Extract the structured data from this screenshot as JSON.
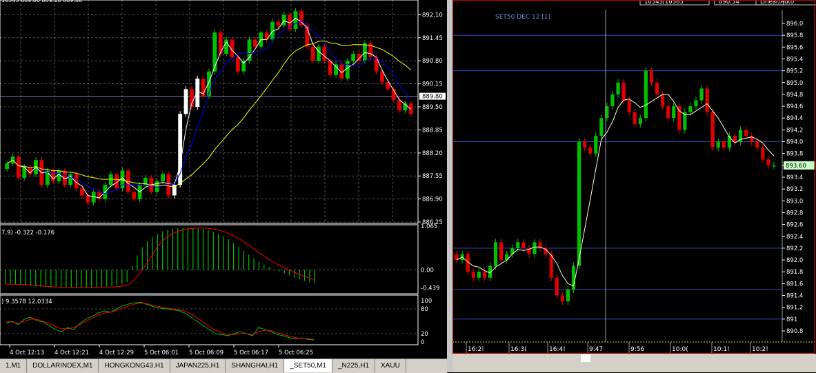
{
  "left_chart": {
    "price_labels": [
      "892.10",
      "891.45",
      "890.80",
      "890.15",
      "889.50",
      "888.85",
      "888.20",
      "887.55",
      "886.90",
      "886.25"
    ],
    "current_price": "889.80",
    "macd_label": "7,9) -0.322 -0.176",
    "macd_ticks": [
      "1.065",
      "0.00",
      "-0.439"
    ],
    "stoch_label": ") 9.3578 12.0334",
    "stoch_ticks": [
      "100",
      "80",
      "20",
      "0"
    ],
    "time_labels": [
      "4 Oct 12:13",
      "4 Oct 12:21",
      "4 Oct 12:29",
      "5 Oct 06:01",
      "5 Oct 06:09",
      "5 Oct 06:17",
      "5 Oct 06:25"
    ],
    "top_text": "10343  889.80  889.10  889.80"
  },
  "right_chart": {
    "title": "SET50 DEC 12  [1]",
    "price_labels": [
      "896.0",
      "895.8",
      "895.6",
      "895.4",
      "895.2",
      "895.0",
      "894.8",
      "894.6",
      "894.4",
      "894.2",
      "894.0",
      "893.8",
      "893.6",
      "893.4",
      "893.2",
      "893.0",
      "892.8",
      "892.6",
      "892.4",
      "892.2",
      "892.0",
      "891.8",
      "891.6",
      "891.4",
      "891.2",
      "891",
      "890.8"
    ],
    "current_price": "893.60",
    "time_labels": [
      "16:2!",
      "16:3(",
      "16:4!",
      "9:47",
      "9:56",
      "10:0(",
      "10:1!",
      "10:2!"
    ],
    "cursor_label": "5",
    "top_boxes": [
      "10343/10363",
      "890.34",
      "Linear/Auto"
    ]
  },
  "tabs": [
    {
      "label": "1,M1",
      "active": false
    },
    {
      "label": "DOLLARINDEX,M1",
      "active": false
    },
    {
      "label": "HONGKONG43,H1",
      "active": false
    },
    {
      "label": "JAPAN225,H1",
      "active": false
    },
    {
      "label": "SHANGHAI,H1",
      "active": false
    },
    {
      "label": "_SET50,M1",
      "active": true
    },
    {
      "label": "_N225,H1",
      "active": false
    },
    {
      "label": "XAUU",
      "active": false
    }
  ],
  "chart_data": [
    {
      "type": "candlestick",
      "title": "",
      "ylim": [
        886.25,
        892.4
      ],
      "x_tick_labels": [
        "4 Oct 12:13",
        "4 Oct 12:21",
        "4 Oct 12:29",
        "5 Oct 06:01",
        "5 Oct 06:09",
        "5 Oct 06:17",
        "5 Oct 06:25"
      ],
      "close": [
        887.9,
        888.1,
        887.5,
        887.8,
        887.6,
        888.0,
        887.3,
        887.7,
        887.4,
        887.7,
        887.3,
        887.6,
        887.2,
        887.0,
        886.8,
        887.1,
        886.9,
        887.3,
        887.6,
        887.2,
        887.7,
        887.1,
        886.9,
        887.3,
        887.5,
        887.1,
        887.4,
        887.6,
        887.0,
        887.3,
        889.3,
        890.0,
        889.5,
        890.3,
        889.8,
        890.5,
        891.6,
        891.0,
        891.4,
        890.9,
        890.5,
        890.8,
        891.4,
        891.2,
        891.6,
        891.4,
        891.9,
        891.8,
        892.1,
        891.7,
        892.2,
        891.8,
        891.2,
        890.8,
        891.2,
        890.8,
        890.4,
        890.7,
        890.3,
        890.8,
        891.0,
        890.8,
        891.3,
        890.9,
        890.5,
        890.2,
        890.0,
        889.7,
        889.4,
        889.6,
        889.3
      ],
      "colors": {
        "up": "#00c000",
        "down": "#e00000",
        "candle_up": "#ffffff"
      },
      "lines": [
        {
          "name": "",
          "color": "#ffffff"
        },
        {
          "name": "",
          "color": "#0000ff"
        },
        {
          "name": "",
          "color": "#ffff00"
        }
      ]
    },
    {
      "type": "bar",
      "title": "",
      "ylim": [
        -0.55,
        1.065
      ],
      "macd_hist": [
        -0.35,
        -0.35,
        -0.36,
        -0.37,
        -0.38,
        -0.4,
        -0.41,
        -0.42,
        -0.42,
        -0.43,
        -0.43,
        -0.44,
        -0.44,
        -0.44,
        -0.44,
        -0.44,
        -0.43,
        -0.43,
        -0.42,
        -0.42,
        -0.41,
        -0.4,
        -0.38,
        -0.36,
        -0.3,
        0.1,
        0.35,
        0.55,
        0.7,
        0.8,
        0.88,
        0.94,
        0.98,
        1.0,
        1.01,
        1.02,
        1.03,
        1.03,
        1.02,
        1.0,
        0.97,
        0.93,
        0.88,
        0.82,
        0.74,
        0.65,
        0.56,
        0.46,
        0.37,
        0.28,
        0.2,
        0.13,
        0.07,
        0.02,
        -0.04,
        -0.09,
        -0.14,
        -0.19,
        -0.23,
        -0.27,
        -0.3,
        -0.32
      ],
      "signal_color": "#ff0000",
      "hist_color": "#00c000"
    },
    {
      "type": "line",
      "title": "",
      "ylim": [
        0,
        100
      ],
      "k": [
        45,
        50,
        42,
        55,
        60,
        52,
        48,
        40,
        30,
        25,
        35,
        30,
        45,
        55,
        62,
        70,
        75,
        72,
        80,
        88,
        92,
        95,
        96,
        90,
        85,
        82,
        80,
        78,
        76,
        70,
        60,
        50,
        40,
        30,
        20,
        18,
        15,
        20,
        25,
        20,
        15,
        35,
        30,
        25,
        18,
        15,
        10,
        8,
        10,
        6,
        5
      ],
      "d": [
        50,
        48,
        45,
        50,
        55,
        55,
        50,
        45,
        38,
        32,
        32,
        35,
        42,
        50,
        58,
        65,
        70,
        72,
        76,
        82,
        88,
        92,
        94,
        92,
        88,
        85,
        82,
        80,
        78,
        75,
        68,
        58,
        48,
        38,
        28,
        22,
        18,
        18,
        20,
        20,
        18,
        25,
        28,
        28,
        22,
        18,
        14,
        10,
        9,
        8,
        6
      ],
      "k_color": "#00c000",
      "d_color": "#ff0000"
    },
    {
      "type": "candlestick",
      "title": "SET50 DEC 12  [1]",
      "ylim": [
        890.8,
        896.0
      ],
      "x_tick_labels": [
        "16:2!",
        "16:3(",
        "16:4!",
        "9:47",
        "9:56",
        "10:0(",
        "10:1!",
        "10:2!"
      ],
      "close": [
        892.0,
        892.1,
        891.8,
        891.7,
        891.8,
        891.7,
        891.9,
        892.3,
        892.0,
        892.1,
        892.2,
        892.3,
        892.2,
        892.1,
        892.3,
        892.2,
        892.1,
        891.7,
        891.4,
        891.3,
        891.5,
        891.9,
        894.0,
        893.9,
        893.8,
        894.1,
        894.4,
        894.6,
        894.8,
        895.0,
        894.7,
        894.5,
        894.3,
        894.4,
        895.2,
        895.0,
        894.8,
        894.6,
        894.4,
        894.6,
        894.2,
        894.5,
        894.6,
        894.7,
        894.9,
        894.5,
        893.9,
        894.0,
        893.9,
        894.1,
        894.0,
        894.2,
        894.1,
        894.0,
        893.9,
        893.7,
        893.6,
        893.6
      ],
      "colors": {
        "up": "#00c000",
        "down": "#e00000"
      },
      "line_color": "#ffffcc"
    }
  ]
}
